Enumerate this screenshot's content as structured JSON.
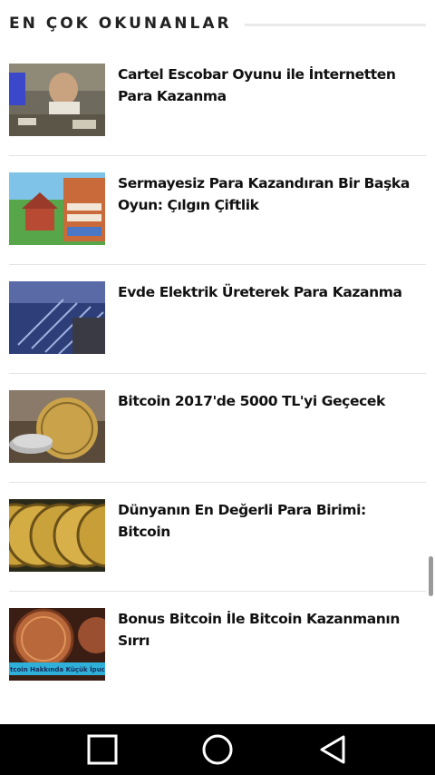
{
  "section": {
    "title": "EN ÇOK OKUNANLAR"
  },
  "articles": [
    {
      "title": "Cartel Escobar Oyunu ile İnternetten Para Kazanma"
    },
    {
      "title": "Sermayesiz Para Kazandıran Bir Başka Oyun: Çılgın Çiftlik"
    },
    {
      "title": "Evde Elektrik Üreterek Para Kazanma"
    },
    {
      "title": "Bitcoin 2017'de 5000 TL'yi Geçecek"
    },
    {
      "title": "Dünyanın En Değerli Para Birimi: Bitcoin"
    },
    {
      "title": "Bonus Bitcoin İle Bitcoin Kazanmanın Sırrı",
      "thumb_caption": "tcoin Hakkında Küçük İpuc"
    }
  ],
  "nav": {
    "recents_icon": "square-icon",
    "home_icon": "circle-icon",
    "back_icon": "triangle-back-icon"
  },
  "colors": {
    "background": "#ffffff",
    "navbar": "#000000",
    "title_text": "#111111"
  }
}
